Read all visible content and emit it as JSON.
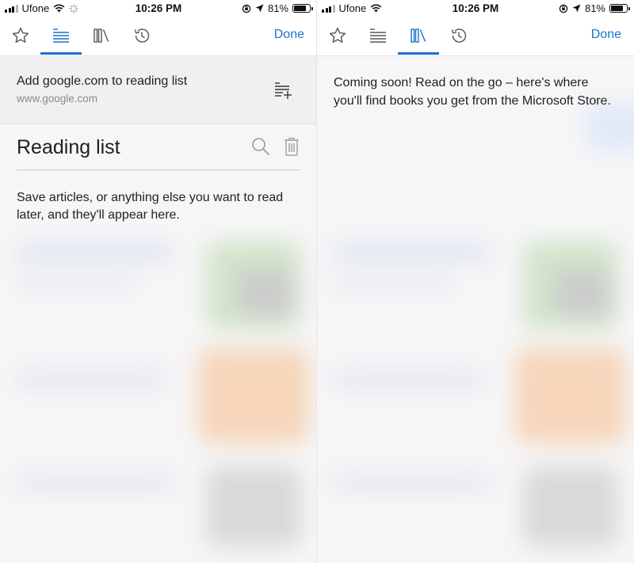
{
  "status_bar": {
    "carrier": "Ufone",
    "time": "10:26 PM",
    "battery_percent": "81%",
    "battery_level": 0.81
  },
  "toolbar": {
    "tabs": [
      {
        "id": "favorites",
        "icon": "star-icon"
      },
      {
        "id": "reading-list",
        "icon": "reading-list-icon"
      },
      {
        "id": "books",
        "icon": "books-icon"
      },
      {
        "id": "history",
        "icon": "history-icon"
      }
    ],
    "done_label": "Done",
    "accent_color": "#1a73c8"
  },
  "left_panel": {
    "active_tab": "reading-list",
    "add_banner": {
      "title": "Add google.com to reading list",
      "url": "www.google.com"
    },
    "section_title": "Reading list",
    "empty_message": "Save articles, or anything else you want to read later, and they'll appear here."
  },
  "right_panel": {
    "active_tab": "books",
    "message": "Coming soon! Read on the go – here's where you'll find books you get from the Microsoft Store."
  }
}
